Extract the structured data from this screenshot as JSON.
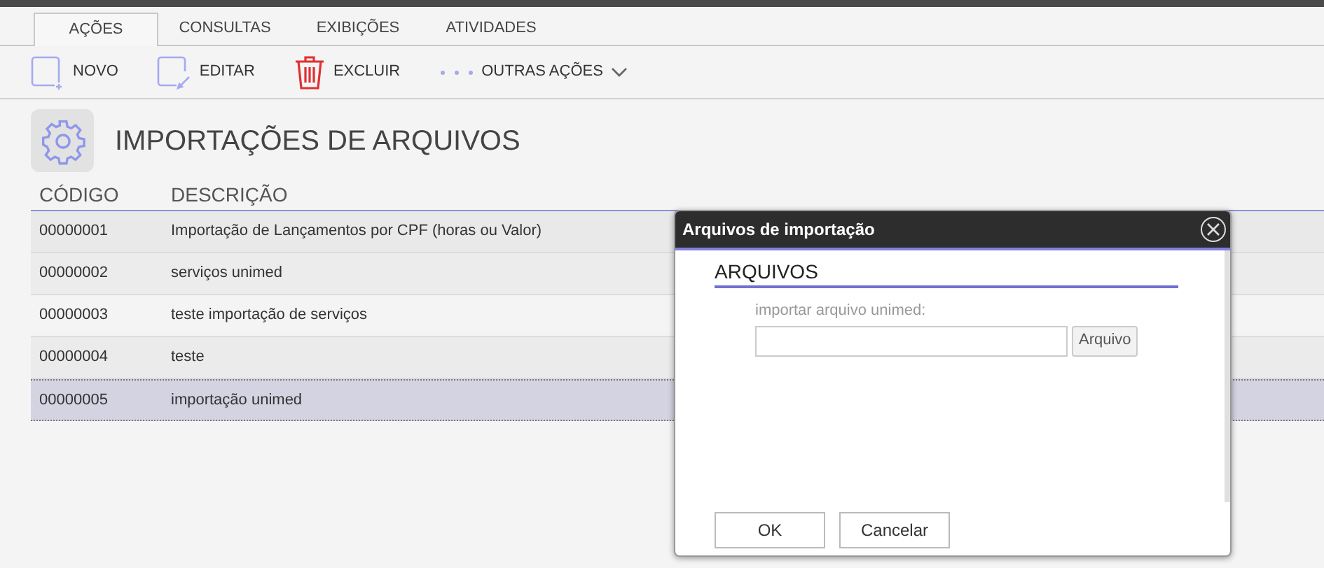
{
  "tabs": [
    {
      "label": "AÇÕES",
      "selected": true
    },
    {
      "label": "CONSULTAS",
      "selected": false
    },
    {
      "label": "EXIBIÇÕES",
      "selected": false
    },
    {
      "label": "ATIVIDADES",
      "selected": false
    }
  ],
  "toolbar": [
    {
      "kind": "new",
      "label": "NOVO"
    },
    {
      "kind": "edit",
      "label": "EDITAR"
    },
    {
      "kind": "delete",
      "label": "EXCLUIR"
    },
    {
      "kind": "more",
      "label": "OUTRAS AÇÕES"
    }
  ],
  "page_title": "IMPORTAÇÕES DE ARQUIVOS",
  "table": {
    "columns": [
      "CÓDIGO",
      "DESCRIÇÃO"
    ],
    "rows": [
      {
        "code": "00000001",
        "description": "Importação de Lançamentos por CPF (horas ou Valor)",
        "selected": false
      },
      {
        "code": "00000002",
        "description": "serviços unimed",
        "selected": false
      },
      {
        "code": "00000003",
        "description": "teste importação de serviços",
        "selected": false
      },
      {
        "code": "00000004",
        "description": "teste",
        "selected": false
      },
      {
        "code": "00000005",
        "description": "importação unimed",
        "selected": true
      }
    ]
  },
  "dialog": {
    "title": "Arquivos de importação",
    "section": "ARQUIVOS",
    "field_label": "importar arquivo unimed:",
    "browse_button": "Arquivo",
    "buttons": [
      "OK",
      "Cancelar"
    ]
  }
}
